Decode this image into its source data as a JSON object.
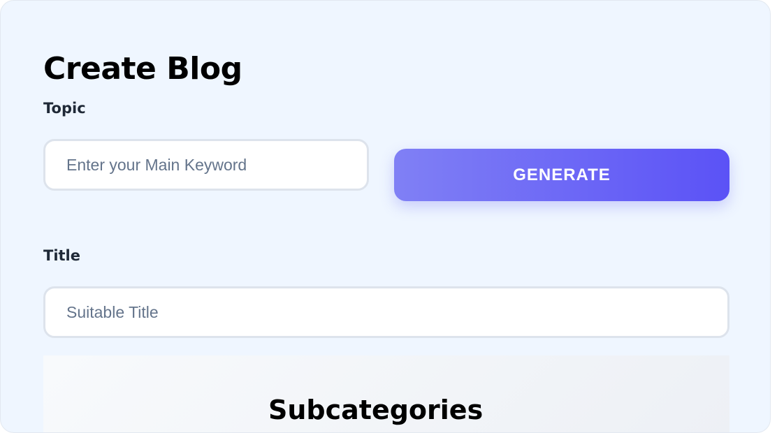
{
  "page": {
    "title": "Create Blog"
  },
  "topic": {
    "label": "Topic",
    "value": "",
    "placeholder": "Enter your Main Keyword"
  },
  "generate": {
    "label": "GENERATE"
  },
  "title_field": {
    "label": "Title",
    "value": "",
    "placeholder": "Suitable Title"
  },
  "sub_panel": {
    "heading": "Subcategories"
  },
  "colors": {
    "card_background": "#eff6ff",
    "button_gradient_start": "#8080f5",
    "button_gradient_end": "#5b52f6",
    "input_border": "#dde3ec",
    "placeholder": "#64748b"
  }
}
